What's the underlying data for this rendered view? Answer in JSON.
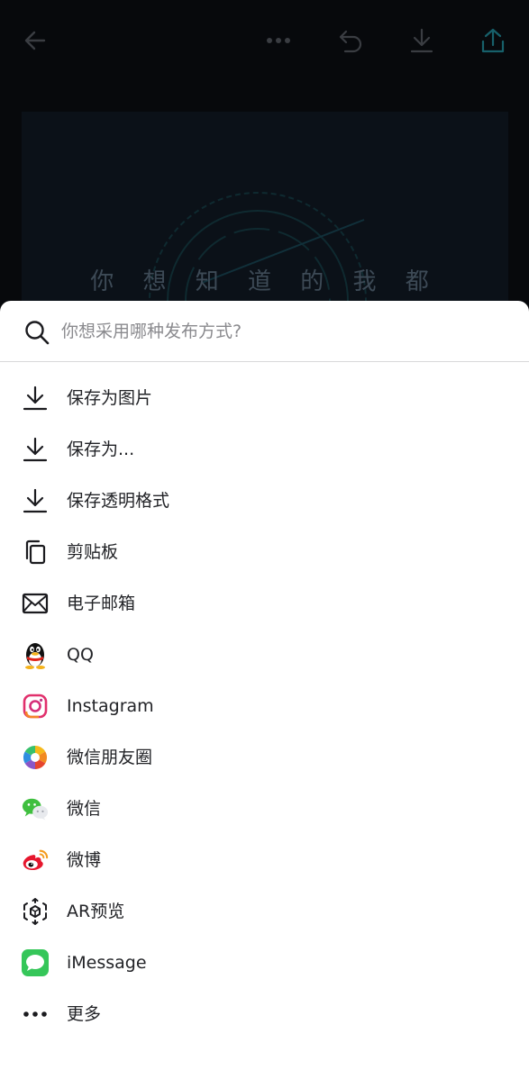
{
  "editor": {
    "design_text": "你 想 知 道 的 我 都"
  },
  "topbar": {
    "back_icon": "arrow-left-icon",
    "more_icon": "more-horizontal-icon",
    "undo_icon": "undo-icon",
    "download_icon": "download-icon",
    "share_icon": "share-icon",
    "accent_color": "#1aa9b8"
  },
  "share_sheet": {
    "search": {
      "placeholder": "你想采用哪种发布方式?",
      "value": "",
      "icon": "search-icon"
    },
    "items": [
      {
        "label": "保存为图片",
        "icon": "download-icon"
      },
      {
        "label": "保存为...",
        "icon": "download-icon"
      },
      {
        "label": "保存透明格式",
        "icon": "download-icon"
      },
      {
        "label": "剪贴板",
        "icon": "copy-icon"
      },
      {
        "label": "电子邮箱",
        "icon": "mail-icon"
      },
      {
        "label": "QQ",
        "icon": "qq-icon"
      },
      {
        "label": "Instagram",
        "icon": "instagram-icon"
      },
      {
        "label": "微信朋友圈",
        "icon": "moments-icon"
      },
      {
        "label": "微信",
        "icon": "wechat-icon"
      },
      {
        "label": "微博",
        "icon": "weibo-icon"
      },
      {
        "label": "AR预览",
        "icon": "ar-icon"
      },
      {
        "label": "iMessage",
        "icon": "imessage-icon"
      },
      {
        "label": "更多",
        "icon": "more-icon"
      }
    ]
  }
}
